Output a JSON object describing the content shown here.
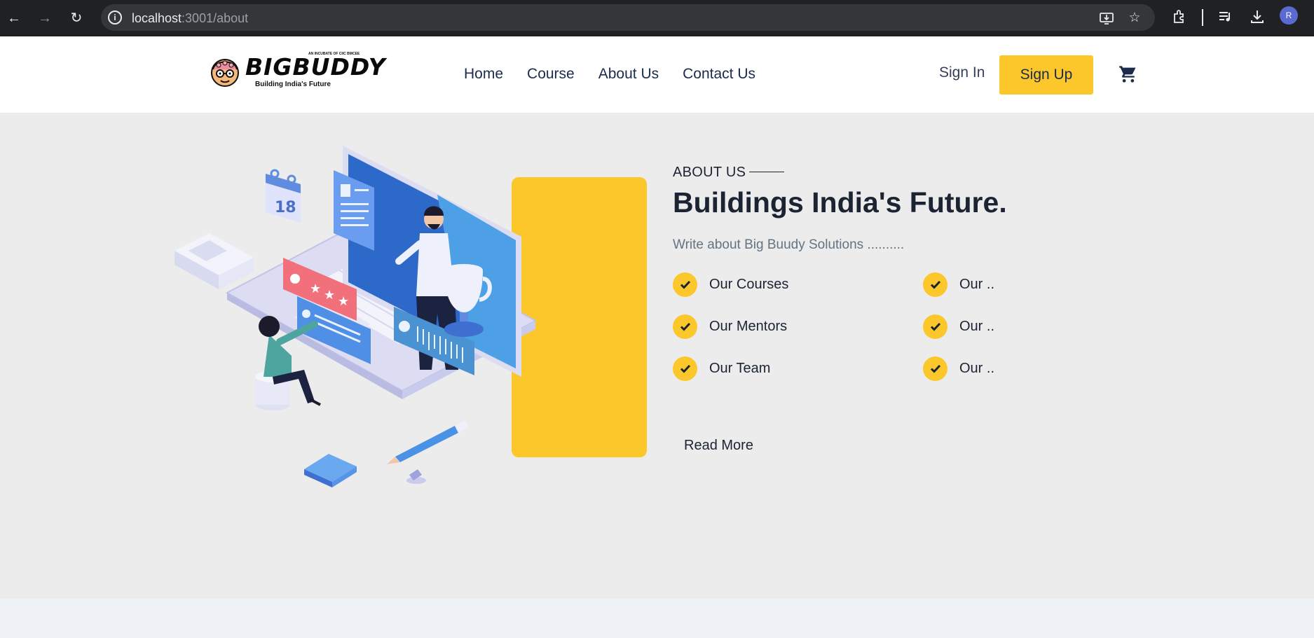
{
  "browser": {
    "url_host": "localhost",
    "url_path": ":3001/about",
    "profile_initial": "R"
  },
  "header": {
    "logo": {
      "word": "BIGBUDDY",
      "tagline": "Building India's Future",
      "topline": "AN INCUBATE OF CIIC BMCEE"
    },
    "nav": [
      {
        "label": "Home"
      },
      {
        "label": "Course"
      },
      {
        "label": "About Us"
      },
      {
        "label": "Contact Us"
      }
    ],
    "sign_in": "Sign In",
    "sign_up": "Sign Up",
    "cart_icon": "cart-icon"
  },
  "about": {
    "eyebrow": "ABOUT US",
    "headline": "Buildings India's Future.",
    "blurb": "Write about Big Buudy Solutions ..........",
    "features_left": [
      "Our Courses",
      "Our Mentors",
      "Our Team"
    ],
    "features_right": [
      "Our ..",
      "Our ..",
      "Our .."
    ],
    "read_more": "Read More",
    "illustration": {
      "calendar_day": "18"
    }
  },
  "colors": {
    "accent": "#fbc72b",
    "heading": "#1c2433",
    "nav_text": "#1c2b4a",
    "section_bg": "#ececec"
  }
}
